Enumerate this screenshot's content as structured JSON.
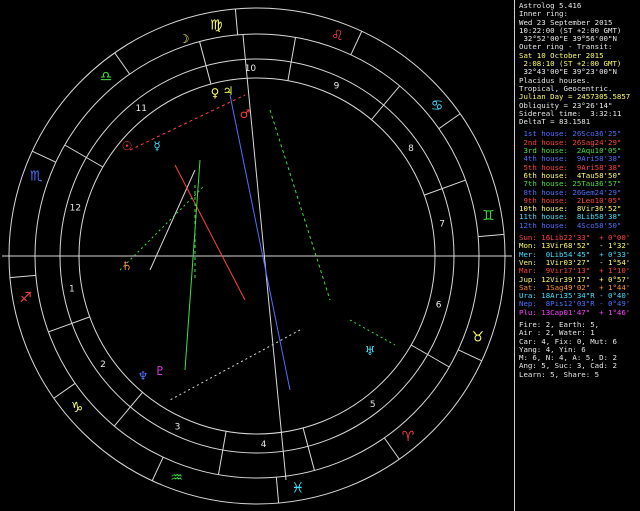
{
  "colors": {
    "background": "#000000",
    "text": "#e8e8e8",
    "line": "#d9d9d9",
    "yellow": "#ffff66",
    "red": "#ff4040",
    "blue": "#5070ff",
    "green": "#40e040",
    "cyan": "#40e0ff",
    "magenta": "#ff40ff",
    "orange": "#ff9030"
  },
  "panel": {
    "app_title": "Astrolog 5.416",
    "inner_label": "Inner ring:",
    "inner_date": "Wed 23 September 2015",
    "inner_time": "10:22:00 (ST +2:00 GMT)",
    "inner_coords": " 32°52'00\"E 39°56'00\"N",
    "outer_label": "Outer ring - Transit:",
    "outer_date": "Sat 10 October 2015",
    "outer_time": " 2:08:10 (ST +2:00 GMT)",
    "outer_coords": " 32°43'00\"E 39°23'00\"N",
    "system1": "Placidus houses.",
    "system2": "Tropical, Geocentric.",
    "julian": "Julian Day = 2457305.5857",
    "obliquity": "Obliquity = 23°26'14\"",
    "sidereal": "Sidereal time:  3:32:11",
    "deltat": "DeltaT = 83.1581",
    "houses": [
      {
        "text": " 1st house: 26Sco36'25\"",
        "color": "#5070ff"
      },
      {
        "text": " 2nd house: 26Sag24'29\"",
        "color": "#ff4040"
      },
      {
        "text": " 3rd house:  2Aqu10'05\"",
        "color": "#40e040"
      },
      {
        "text": " 4th house:  9Ari58'38\"",
        "color": "#5070ff"
      },
      {
        "text": " 5th house:  9Ari58'38\"",
        "color": "#ff4040"
      },
      {
        "text": " 6th house:  4Tau58'50\"",
        "color": "#ffff66"
      },
      {
        "text": " 7th house: 25Tau36'57\"",
        "color": "#40e040"
      },
      {
        "text": " 8th house: 26Gem24'29\"",
        "color": "#5070ff"
      },
      {
        "text": " 9th house:  2Leo10'05\"",
        "color": "#ff4040"
      },
      {
        "text": "10th house:  8Vir36'52\"",
        "color": "#ffff66"
      },
      {
        "text": "11th house:  8Lib58'38\"",
        "color": "#40e0ff"
      },
      {
        "text": "12th house:  4Sco58'50\"",
        "color": "#5070ff"
      }
    ],
    "planets": [
      {
        "text": "Sun: 16Lib22'33\"  + 0°00'",
        "color": "#ff4040"
      },
      {
        "text": "Mon: 13Vir68'52\"  - 1°32'",
        "color": "#ffff66"
      },
      {
        "text": "Mer:  0Lib54'45\"  + 0°33'",
        "color": "#40e0ff"
      },
      {
        "text": "Ven:  1Vir03'27\"  - 1°54'",
        "color": "#ffff66"
      },
      {
        "text": "Mar:  9Vir17'13\"  + 1°10'",
        "color": "#ff4040"
      },
      {
        "text": "Jup: 12Vir39'17\"  + 0°57'",
        "color": "#ffff66"
      },
      {
        "text": "Sat:  1Sag49'02\"  + 1°44'",
        "color": "#ff9030"
      },
      {
        "text": "Ura: 18Ari35'34\"R - 0°40'",
        "color": "#40e0ff"
      },
      {
        "text": "Nep:  8Pis12'03\"R - 0°49'",
        "color": "#5070ff"
      },
      {
        "text": "Plu: 13Cap01'47\"  + 1°46'",
        "color": "#ff40ff"
      }
    ],
    "elements": [
      "Fire: 2, Earth: 5,",
      "Air : 2, Water: 1",
      "Car: 4, Fix: 0, Mut: 6",
      "Yang: 4, Yin: 6",
      "M: 6, N: 4, A: 5, D: 2",
      "Ang: 5, Suc: 3, Cad: 2",
      "Learn: 5, Share: 5"
    ]
  },
  "wheel": {
    "house_numbers": [
      "1",
      "2",
      "3",
      "4",
      "5",
      "6",
      "7",
      "8",
      "9",
      "10",
      "11",
      "12"
    ],
    "signs": [
      {
        "glyph": "♍",
        "color": "#ffff66"
      },
      {
        "glyph": "♌",
        "color": "#ff4040"
      },
      {
        "glyph": "♋",
        "color": "#40e0ff"
      },
      {
        "glyph": "♊",
        "color": "#40e040"
      },
      {
        "glyph": "♉",
        "color": "#ffff66"
      },
      {
        "glyph": "♈",
        "color": "#ff4040"
      },
      {
        "glyph": "♓",
        "color": "#40e0ff"
      },
      {
        "glyph": "♒",
        "color": "#40e040"
      },
      {
        "glyph": "♑",
        "color": "#ffff66"
      },
      {
        "glyph": "♐",
        "color": "#ff4040"
      },
      {
        "glyph": "♏",
        "color": "#5070ff"
      },
      {
        "glyph": "♎",
        "color": "#40e040"
      }
    ],
    "planet_glyphs": [
      {
        "glyph": "☉",
        "color": "#ff4040"
      },
      {
        "glyph": "☽",
        "color": "#ffff66"
      },
      {
        "glyph": "☿",
        "color": "#40e0ff"
      },
      {
        "glyph": "♀",
        "color": "#ffff66"
      },
      {
        "glyph": "♂",
        "color": "#ff4040"
      },
      {
        "glyph": "♃",
        "color": "#ffff66"
      },
      {
        "glyph": "♄",
        "color": "#ff9030"
      },
      {
        "glyph": "♅",
        "color": "#40e0ff"
      },
      {
        "glyph": "♆",
        "color": "#5070ff"
      },
      {
        "glyph": "♇",
        "color": "#ff40ff"
      }
    ]
  }
}
